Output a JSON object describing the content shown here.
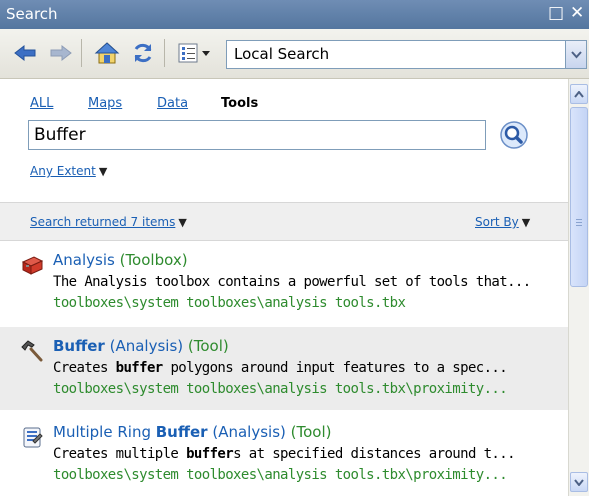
{
  "window": {
    "title": "Search",
    "restore_glyph": "□",
    "close_glyph": "✕"
  },
  "toolbar": {
    "icons": [
      "back-arrow-icon",
      "forward-arrow-icon",
      "home-icon",
      "refresh-icon",
      "view-options-icon",
      "dropdown-arrow-icon"
    ],
    "location_value": "Local Search"
  },
  "tabs": [
    {
      "label": "ALL",
      "active": false
    },
    {
      "label": "Maps",
      "active": false
    },
    {
      "label": "Data",
      "active": false
    },
    {
      "label": "Tools",
      "active": true
    }
  ],
  "search": {
    "value": "Buffer"
  },
  "extent": {
    "label": "Any Extent"
  },
  "status": {
    "summary": "Search returned 7 items",
    "sort_label": "Sort By"
  },
  "results": [
    {
      "title_pre": "Analysis",
      "title_bold": "",
      "title_post": "",
      "kind": "(Toolbox)",
      "desc_pre": "The Analysis toolbox contains a powerful set of tools that...",
      "desc_bold": "",
      "desc_post": "",
      "path": "toolboxes\\system toolboxes\\analysis tools.tbx",
      "icon": "toolbox-icon"
    },
    {
      "title_pre": "",
      "title_bold": "Buffer",
      "title_post": " (Analysis)",
      "kind": "(Tool)",
      "desc_pre": "Creates ",
      "desc_bold": "buffer",
      "desc_post": " polygons around input features to a spec...",
      "path": "toolboxes\\system toolboxes\\analysis tools.tbx\\proximity...",
      "icon": "hammer-tool-icon"
    },
    {
      "title_pre": "Multiple Ring ",
      "title_bold": "Buffer",
      "title_post": " (Analysis)",
      "kind": "(Tool)",
      "desc_pre": "Creates multiple ",
      "desc_bold": "buffer",
      "desc_post": "s at specified distances around t...",
      "path": "toolboxes\\system toolboxes\\analysis tools.tbx\\proximity...",
      "icon": "script-tool-icon"
    }
  ],
  "colors": {
    "link": "#1a5fb4",
    "kind_green": "#2e8b2e",
    "titlebar": "#5f7fa8"
  }
}
